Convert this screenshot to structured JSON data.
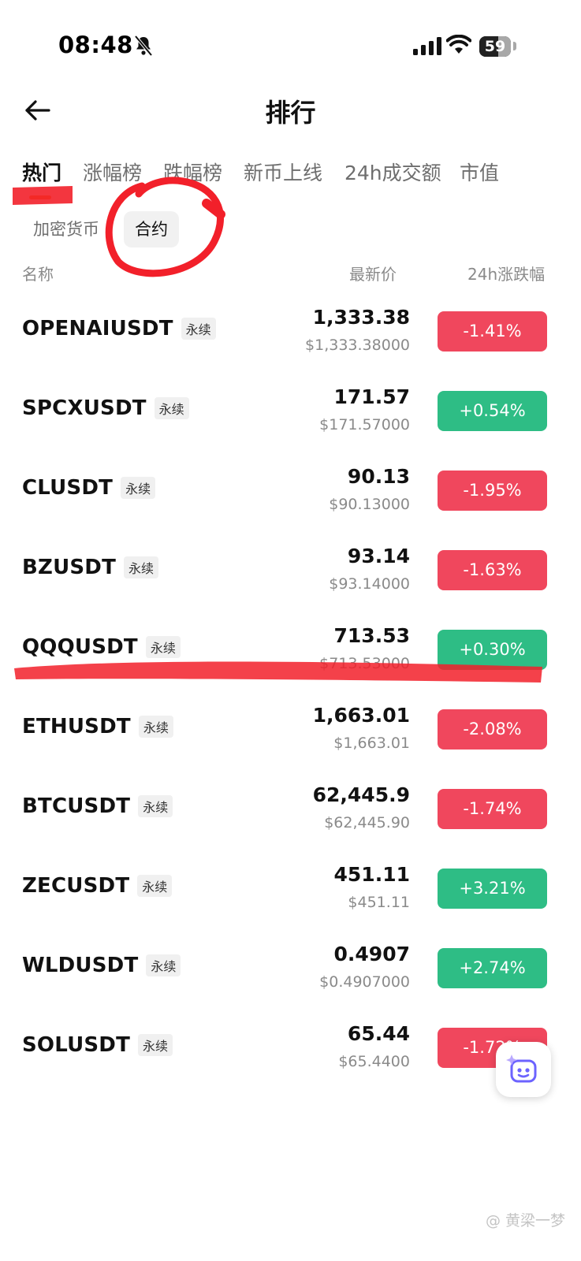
{
  "status_bar": {
    "time": "08:48",
    "battery": "59",
    "battery_level": 0.59
  },
  "header": {
    "title": "排行",
    "back_icon": "arrow-left-icon"
  },
  "tabs": [
    {
      "label": "热门",
      "active": true
    },
    {
      "label": "涨幅榜",
      "active": false
    },
    {
      "label": "跌幅榜",
      "active": false
    },
    {
      "label": "新币上线",
      "active": false
    },
    {
      "label": "24h成交额",
      "active": false
    },
    {
      "label": "市值",
      "active": false
    }
  ],
  "segments": [
    {
      "label": "加密货币",
      "active": false
    },
    {
      "label": "合约",
      "active": true
    }
  ],
  "columns": {
    "name": "名称",
    "price": "最新价",
    "change": "24h涨跌幅"
  },
  "colors": {
    "up": "#2ebd85",
    "down": "#f0475d",
    "accent": "#ff7a00",
    "annotation": "#f2202a"
  },
  "tickers": [
    {
      "symbol": "OPENAIUSDT",
      "badge": "永续",
      "price": "1,333.38",
      "usd": "$1,333.38000",
      "change": "-1.41%",
      "direction": "down"
    },
    {
      "symbol": "SPCXUSDT",
      "badge": "永续",
      "price": "171.57",
      "usd": "$171.57000",
      "change": "+0.54%",
      "direction": "up"
    },
    {
      "symbol": "CLUSDT",
      "badge": "永续",
      "price": "90.13",
      "usd": "$90.13000",
      "change": "-1.95%",
      "direction": "down"
    },
    {
      "symbol": "BZUSDT",
      "badge": "永续",
      "price": "93.14",
      "usd": "$93.14000",
      "change": "-1.63%",
      "direction": "down"
    },
    {
      "symbol": "QQQUSDT",
      "badge": "永续",
      "price": "713.53",
      "usd": "$713.53000",
      "change": "+0.30%",
      "direction": "up"
    },
    {
      "symbol": "ETHUSDT",
      "badge": "永续",
      "price": "1,663.01",
      "usd": "$1,663.01",
      "change": "-2.08%",
      "direction": "down"
    },
    {
      "symbol": "BTCUSDT",
      "badge": "永续",
      "price": "62,445.9",
      "usd": "$62,445.90",
      "change": "-1.74%",
      "direction": "down"
    },
    {
      "symbol": "ZECUSDT",
      "badge": "永续",
      "price": "451.11",
      "usd": "$451.11",
      "change": "+3.21%",
      "direction": "up"
    },
    {
      "symbol": "WLDUSDT",
      "badge": "永续",
      "price": "0.4907",
      "usd": "$0.4907000",
      "change": "+2.74%",
      "direction": "up"
    },
    {
      "symbol": "SOLUSDT",
      "badge": "永续",
      "price": "65.44",
      "usd": "$65.4400",
      "change": "-1.72%",
      "direction": "down"
    }
  ],
  "fab": {
    "icon": "ai-assistant-icon"
  },
  "watermark": "@ 黄梁一梦"
}
